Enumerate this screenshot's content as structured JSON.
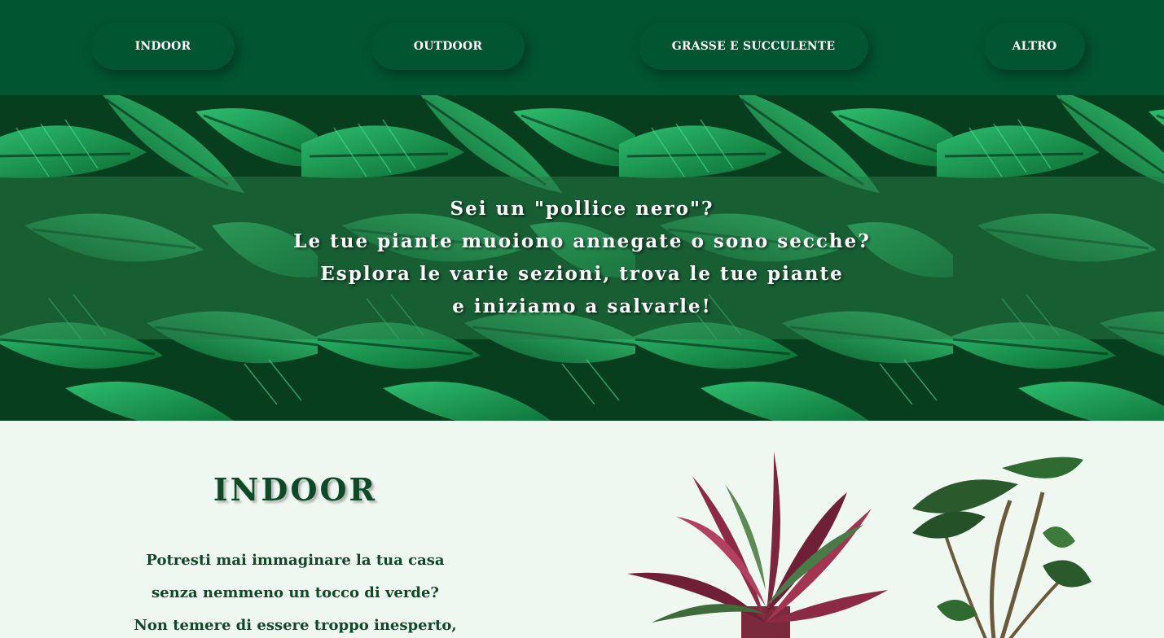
{
  "nav": {
    "items": [
      {
        "label": "INDOOR"
      },
      {
        "label": "OUTDOOR"
      },
      {
        "label": "GRASSE E SUCCULENTE"
      },
      {
        "label": "ALTRO"
      }
    ]
  },
  "hero": {
    "lines": [
      "Sei un \"pollice nero\"?",
      "Le tue piante muoiono annegate o sono secche?",
      "Esplora le varie sezioni, trova le tue piante",
      "e iniziamo a salvarle!"
    ]
  },
  "section": {
    "title": "INDOOR",
    "body_lines": [
      "Potresti mai immaginare la tua casa",
      "senza nemmeno un tocco di verde?",
      "Non temere di essere troppo inesperto,"
    ]
  },
  "colors": {
    "nav_bg": "#015530",
    "section_bg": "#eef7f0",
    "title_color": "#0e4a25",
    "leaf_green": "#1f9a55"
  },
  "images": {
    "hero_background": "tropical-leaves-image",
    "plant_left": "calathea-plant-image",
    "plant_right": "alocasia-plant-image"
  }
}
